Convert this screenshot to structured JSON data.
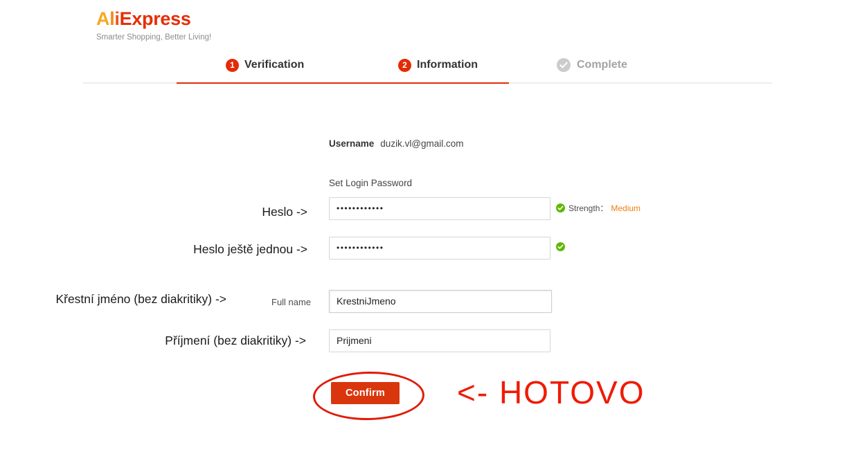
{
  "brand": {
    "name_part_a": "A",
    "name_part_l": "l",
    "name_part_i": "i",
    "name_part_express": "Express",
    "tagline": "Smarter Shopping, Better Living!"
  },
  "steps": [
    {
      "badge": "1",
      "label": "Verification",
      "state": "active"
    },
    {
      "badge": "2",
      "label": "Information",
      "state": "active"
    },
    {
      "badge": "check-icon",
      "label": "Complete",
      "state": "pending"
    }
  ],
  "form": {
    "username_label": "Username",
    "username_value": "duzik.vl@gmail.com",
    "password_section_label": "Set Login Password",
    "password_value": "••••••••••••",
    "password_confirm_value": "••••••••••••",
    "strength_label": "Strength：",
    "strength_value": "Medium",
    "fullname_label": "Full name",
    "fullname_value": "KrestniJmeno",
    "lastname_value": "Prijmeni",
    "confirm_label": "Confirm"
  },
  "annotations": {
    "password": "Heslo ->",
    "password_again": "Heslo ještě jednou ->",
    "firstname": "Křestní jméno (bez diakritiky) ->",
    "lastname": "Příjmení (bez diakritiky) ->",
    "done": "<- HOTOVO"
  },
  "colors": {
    "brand_red": "#e62e04",
    "brand_orange": "#f7a823",
    "step_active": "#e32b07",
    "step_pending": "#cccccc",
    "button_red": "#d9360e",
    "annotation_red": "#ef1b06",
    "strength_green": "#5eb800",
    "strength_orange": "#ef7e10"
  }
}
